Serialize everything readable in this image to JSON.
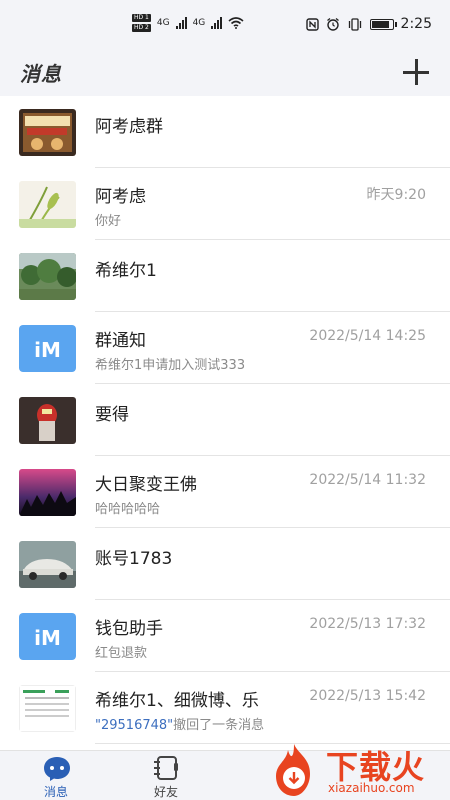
{
  "status_bar": {
    "hd1": "HD 1",
    "hd2": "HD 2",
    "net1": "4G",
    "net2": "4G",
    "time": "2:25",
    "battery_level": 0.85
  },
  "header": {
    "title": "消息"
  },
  "conversations": [
    {
      "name": "阿考虑群",
      "preview": "",
      "time": ""
    },
    {
      "name": "阿考虑",
      "preview": "你好",
      "time": "昨天9:20"
    },
    {
      "name": "希维尔1",
      "preview": "",
      "time": ""
    },
    {
      "name": "群通知",
      "preview": "希维尔1申请加入测试333",
      "time": "2022/5/14 14:25"
    },
    {
      "name": "要得",
      "preview": "",
      "time": ""
    },
    {
      "name": "大日聚变王佛",
      "preview": "哈哈哈哈哈",
      "time": "2022/5/14 11:32"
    },
    {
      "name": "账号1783",
      "preview": "",
      "time": ""
    },
    {
      "name": "钱包助手",
      "preview": "红包退款",
      "time": "2022/5/13 17:32"
    },
    {
      "name": "希维尔1、细微博、乐",
      "preview_quote": "\"29516748\"",
      "preview": "撤回了一条消息",
      "time": "2022/5/13 15:42"
    }
  ],
  "tabs": [
    {
      "label": "消息"
    },
    {
      "label": "好友"
    }
  ],
  "watermark": {
    "main": "下载火",
    "sub": "xiazaihuo.com"
  },
  "colors": {
    "accent": "#2a5fb5",
    "im_logo_bg": "#5aa5f0",
    "watermark": "#e84420"
  }
}
